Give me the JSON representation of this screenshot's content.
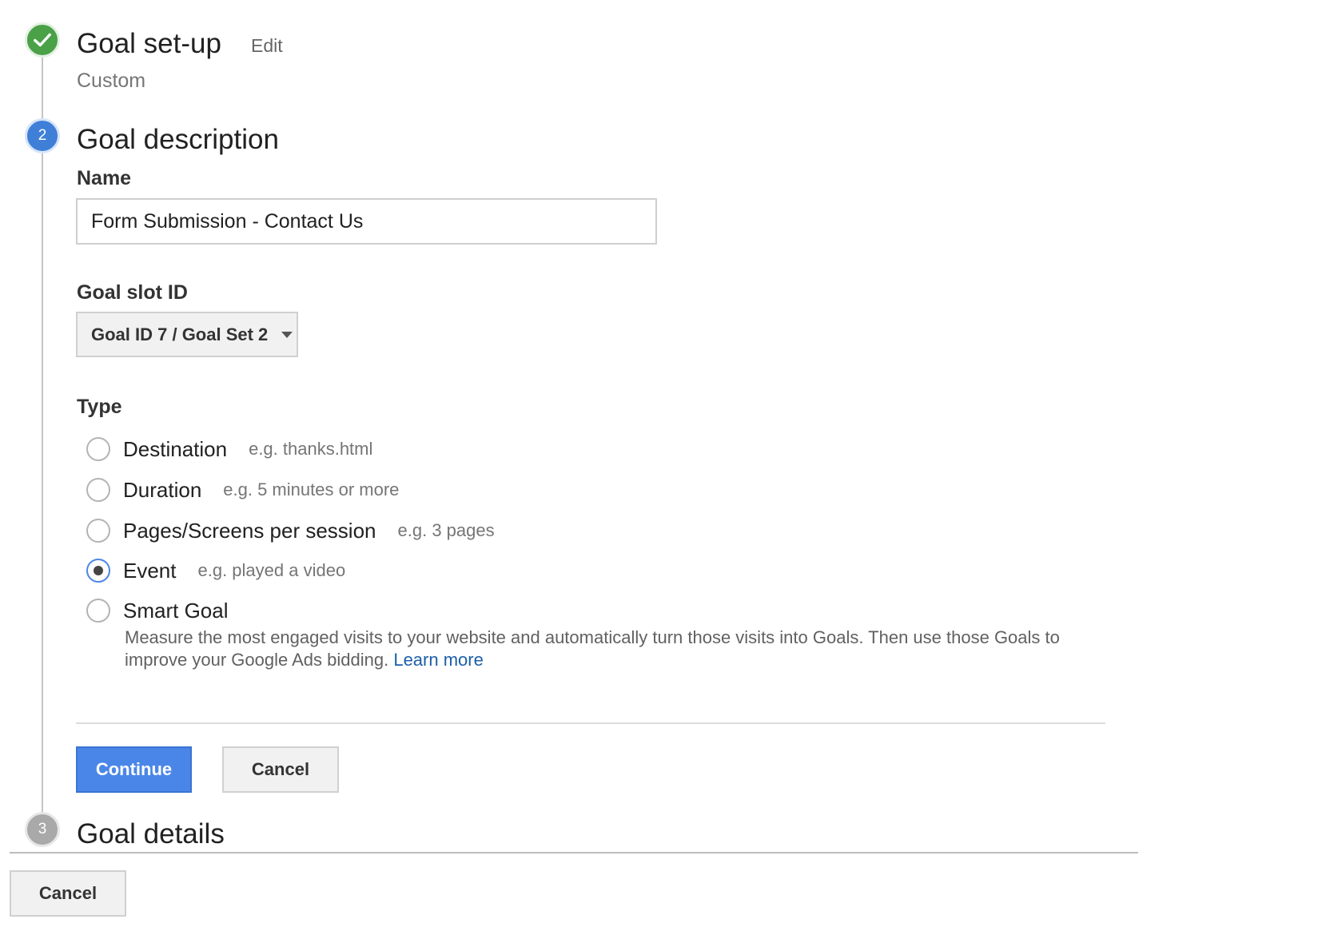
{
  "steps": [
    {
      "number": "",
      "title": "Goal set-up",
      "edit_label": "Edit",
      "subtitle": "Custom"
    },
    {
      "number": "2",
      "title": "Goal description"
    },
    {
      "number": "3",
      "title": "Goal details"
    }
  ],
  "form": {
    "name_label": "Name",
    "name_value": "Form Submission - Contact Us",
    "slot_label": "Goal slot ID",
    "slot_value": "Goal ID 7 / Goal Set 2",
    "type_label": "Type",
    "types": [
      {
        "label": "Destination",
        "hint": "e.g. thanks.html",
        "checked": false
      },
      {
        "label": "Duration",
        "hint": "e.g. 5 minutes or more",
        "checked": false
      },
      {
        "label": "Pages/Screens per session",
        "hint": "e.g. 3 pages",
        "checked": false
      },
      {
        "label": "Event",
        "hint": "e.g. played a video",
        "checked": true
      },
      {
        "label": "Smart Goal",
        "hint": "",
        "checked": false
      }
    ],
    "smart_goal_description": "Measure the most engaged visits to your website and automatically turn those visits into Goals. Then use those Goals to improve your Google Ads bidding.",
    "learn_more_label": "Learn more"
  },
  "buttons": {
    "continue_label": "Continue",
    "cancel_label": "Cancel",
    "footer_cancel_label": "Cancel"
  },
  "colors": {
    "done": "#4aa147",
    "active": "#3f7fd8",
    "inactive": "#a9a9a9",
    "primary_button": "#4a86e8",
    "link": "#1c5fa8"
  },
  "icons": {
    "step_done": "check-icon",
    "slot_caret": "caret-down-icon"
  }
}
